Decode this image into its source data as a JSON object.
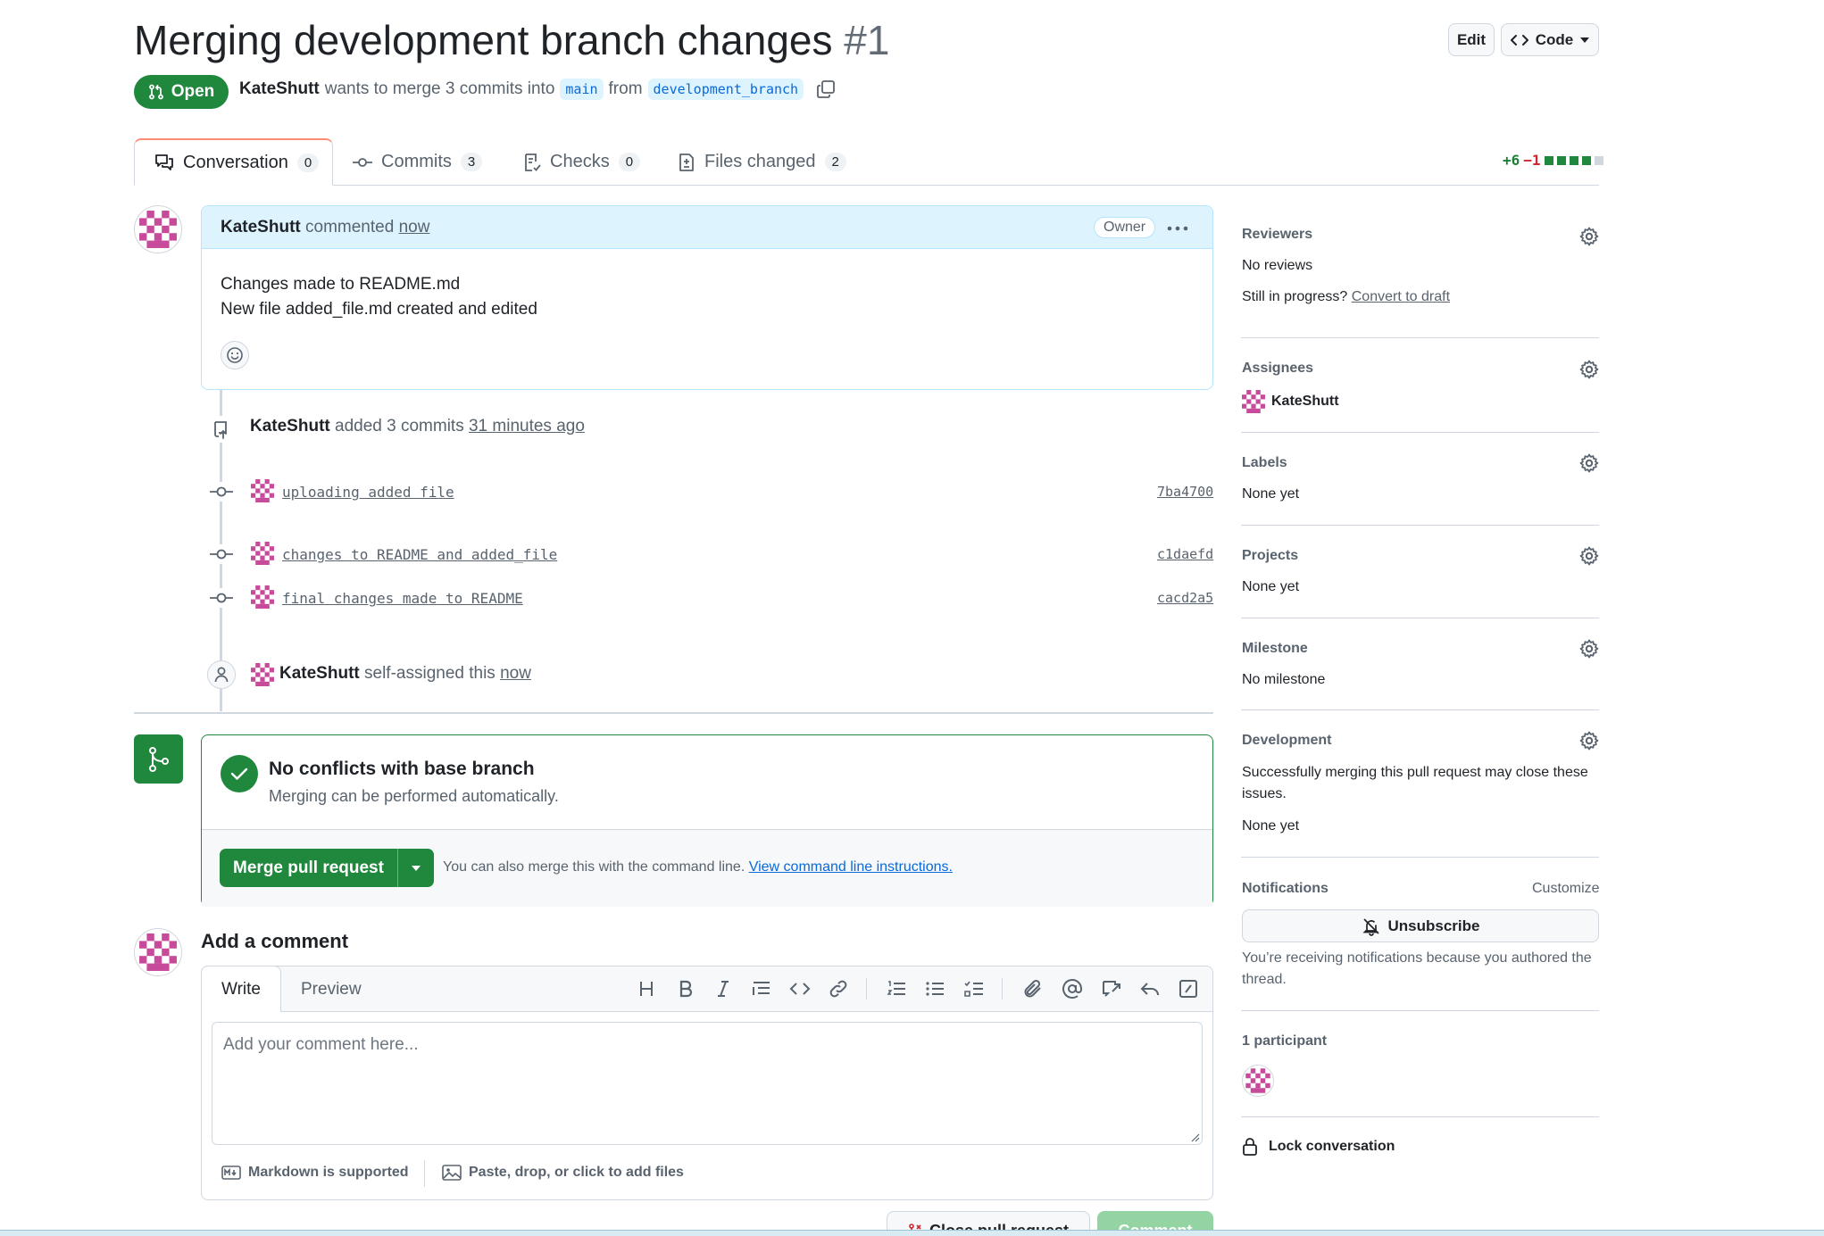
{
  "header": {
    "title": "Merging development branch changes",
    "number": "#1",
    "edit_label": "Edit",
    "code_label": "Code",
    "status": "Open",
    "author": "KateShutt",
    "merge_text": "wants to merge 3 commits into",
    "base_branch": "main",
    "from_text": "from",
    "head_branch": "development_branch"
  },
  "tabs": [
    {
      "label": "Conversation",
      "count": "0"
    },
    {
      "label": "Commits",
      "count": "3"
    },
    {
      "label": "Checks",
      "count": "0"
    },
    {
      "label": "Files changed",
      "count": "2"
    }
  ],
  "diffstat": {
    "additions": "+6",
    "deletions": "−1"
  },
  "comment": {
    "author": "KateShutt",
    "verb": "commented",
    "time": "now",
    "badge": "Owner",
    "lines": [
      "Changes made to README.md",
      "New file added_file.md created and edited"
    ]
  },
  "commits_event": {
    "author": "KateShutt",
    "text": "added 3 commits",
    "time": "31 minutes ago"
  },
  "commits": [
    {
      "message": "uploading added file",
      "sha": "7ba4700"
    },
    {
      "message": "changes to README and added_file",
      "sha": "c1daefd"
    },
    {
      "message": "final changes made to README",
      "sha": "cacd2a5"
    }
  ],
  "assign_event": {
    "author": "KateShutt",
    "text": "self-assigned this",
    "time": "now"
  },
  "merge": {
    "title": "No conflicts with base branch",
    "subtitle": "Merging can be performed automatically.",
    "button": "Merge pull request",
    "hint": "You can also merge this with the command line.",
    "hint_link": "View command line instructions."
  },
  "add_comment": {
    "heading": "Add a comment",
    "write_tab": "Write",
    "preview_tab": "Preview",
    "placeholder": "Add your comment here...",
    "markdown": "Markdown is supported",
    "attach": "Paste, drop, or click to add files",
    "close_button": "Close pull request",
    "comment_button": "Comment"
  },
  "sidebar": {
    "reviewers": {
      "title": "Reviewers",
      "value": "No reviews",
      "draft_prefix": "Still in progress?",
      "draft_link": "Convert to draft"
    },
    "assignees": {
      "title": "Assignees",
      "value": "KateShutt"
    },
    "labels": {
      "title": "Labels",
      "value": "None yet"
    },
    "projects": {
      "title": "Projects",
      "value": "None yet"
    },
    "milestone": {
      "title": "Milestone",
      "value": "No milestone"
    },
    "development": {
      "title": "Development",
      "text": "Successfully merging this pull request may close these issues.",
      "value": "None yet"
    },
    "notifications": {
      "title": "Notifications",
      "customize": "Customize",
      "button": "Unsubscribe",
      "text": "You’re receiving notifications because you authored the thread."
    },
    "participants": {
      "title": "1 participant"
    },
    "lock": "Lock conversation"
  },
  "colors": {
    "accent_green": "#1f883d",
    "link_blue": "#0969da",
    "avatar_pink": "#c74b9a"
  }
}
